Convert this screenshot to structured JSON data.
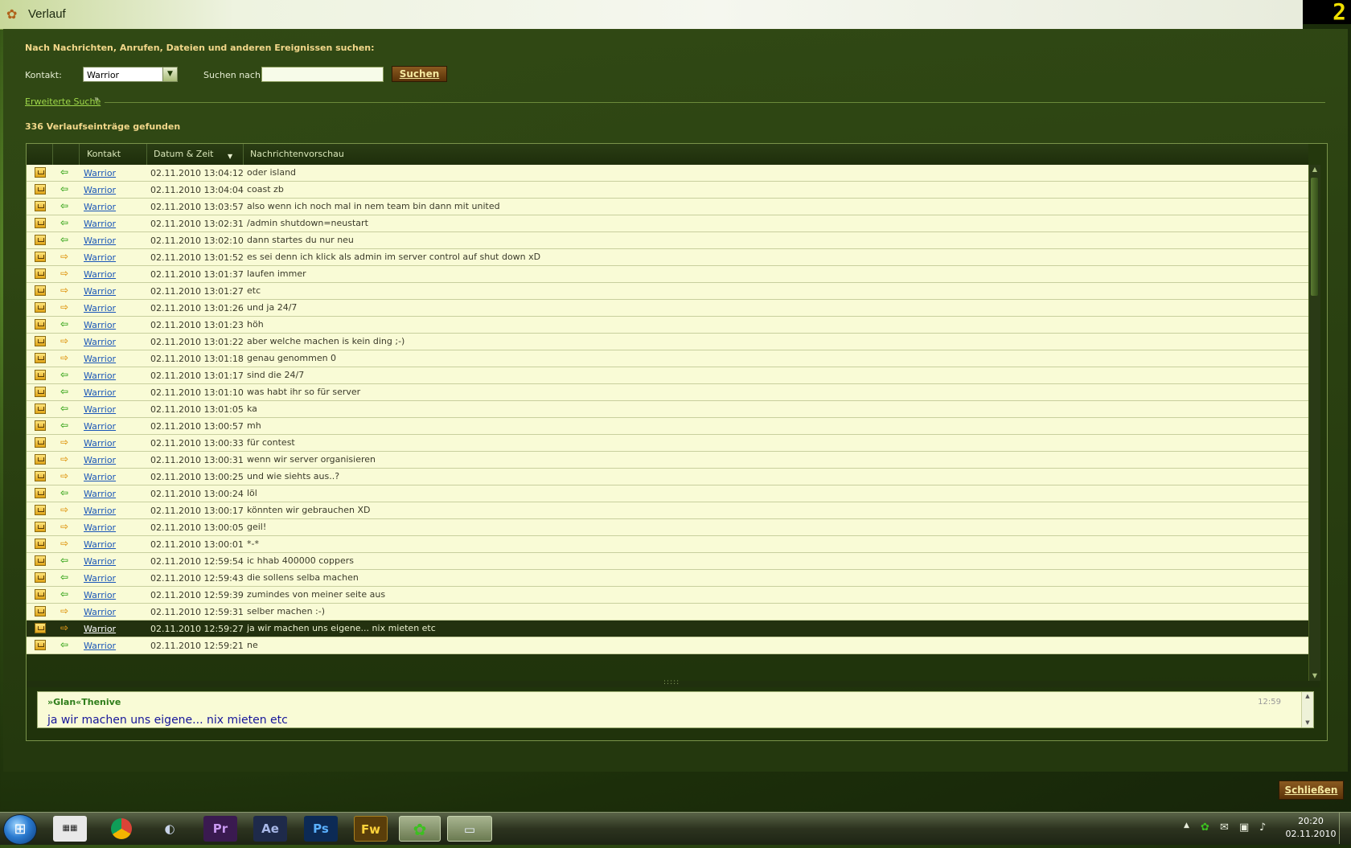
{
  "window": {
    "title": "Verlauf",
    "corner_badge": "2"
  },
  "search": {
    "heading": "Nach Nachrichten, Anrufen, Dateien und anderen Ereignissen suchen:",
    "contact_label": "Kontakt:",
    "contact_value": "Warrior",
    "search_label": "Suchen nach:",
    "search_value": "",
    "search_button": "Suchen",
    "advanced_link": "Erweiterte Suche"
  },
  "results": {
    "count_text": "336 Verlaufseinträge gefunden"
  },
  "grid": {
    "columns": [
      "",
      "",
      "Kontakt",
      "Datum & Zeit",
      "Nachrichtenvorschau"
    ],
    "sort_column": "Datum & Zeit",
    "rows": [
      {
        "dir": "in",
        "contact": "Warrior",
        "date": "02.11.2010 13:04:12",
        "message": " oder island"
      },
      {
        "dir": "in",
        "contact": "Warrior",
        "date": "02.11.2010 13:04:04",
        "message": " coast zb"
      },
      {
        "dir": "in",
        "contact": "Warrior",
        "date": "02.11.2010 13:03:57",
        "message": "also wenn ich noch mal in nem team bin dann mit united"
      },
      {
        "dir": "in",
        "contact": "Warrior",
        "date": "02.11.2010 13:02:31",
        "message": "/admin shutdown=neustart"
      },
      {
        "dir": "in",
        "contact": "Warrior",
        "date": "02.11.2010 13:02:10",
        "message": "dann startes du nur neu"
      },
      {
        "dir": "out",
        "contact": "Warrior",
        "date": "02.11.2010 13:01:52",
        "message": "es sei denn ich klick als admin im server control auf shut down xD"
      },
      {
        "dir": "out",
        "contact": "Warrior",
        "date": "02.11.2010 13:01:37",
        "message": "laufen immer"
      },
      {
        "dir": "out",
        "contact": "Warrior",
        "date": "02.11.2010 13:01:27",
        "message": "etc"
      },
      {
        "dir": "out",
        "contact": "Warrior",
        "date": "02.11.2010 13:01:26",
        "message": "und ja 24/7"
      },
      {
        "dir": "in",
        "contact": "Warrior",
        "date": "02.11.2010 13:01:23",
        "message": " höh"
      },
      {
        "dir": "out",
        "contact": "Warrior",
        "date": "02.11.2010 13:01:22",
        "message": "aber welche machen is kein ding ;-)"
      },
      {
        "dir": "out",
        "contact": "Warrior",
        "date": "02.11.2010 13:01:18",
        "message": "genau genommen 0"
      },
      {
        "dir": "in",
        "contact": "Warrior",
        "date": "02.11.2010 13:01:17",
        "message": " sind die 24/7"
      },
      {
        "dir": "in",
        "contact": "Warrior",
        "date": "02.11.2010 13:01:10",
        "message": " was habt ihr so für server"
      },
      {
        "dir": "in",
        "contact": "Warrior",
        "date": "02.11.2010 13:01:05",
        "message": " ka"
      },
      {
        "dir": "in",
        "contact": "Warrior",
        "date": "02.11.2010 13:00:57",
        "message": " mh"
      },
      {
        "dir": "out",
        "contact": "Warrior",
        "date": "02.11.2010 13:00:33",
        "message": "für contest"
      },
      {
        "dir": "out",
        "contact": "Warrior",
        "date": "02.11.2010 13:00:31",
        "message": "wenn wir server organisieren"
      },
      {
        "dir": "out",
        "contact": "Warrior",
        "date": "02.11.2010 13:00:25",
        "message": "und wie siehts aus..?"
      },
      {
        "dir": "in",
        "contact": "Warrior",
        "date": "02.11.2010 13:00:24",
        "message": " löl"
      },
      {
        "dir": "out",
        "contact": "Warrior",
        "date": "02.11.2010 13:00:17",
        "message": "könnten wir gebrauchen XD"
      },
      {
        "dir": "out",
        "contact": "Warrior",
        "date": "02.11.2010 13:00:05",
        "message": "geil!"
      },
      {
        "dir": "out",
        "contact": "Warrior",
        "date": "02.11.2010 13:00:01",
        "message": "*-*"
      },
      {
        "dir": "in",
        "contact": "Warrior",
        "date": "02.11.2010 12:59:54",
        "message": " ic hhab 400000 coppers"
      },
      {
        "dir": "in",
        "contact": "Warrior",
        "date": "02.11.2010 12:59:43",
        "message": " die sollens selba machen"
      },
      {
        "dir": "in",
        "contact": "Warrior",
        "date": "02.11.2010 12:59:39",
        "message": "zumindes von meiner seite aus"
      },
      {
        "dir": "out",
        "contact": "Warrior",
        "date": "02.11.2010 12:59:31",
        "message": "selber machen :-)"
      },
      {
        "dir": "out",
        "contact": "Warrior",
        "date": "02.11.2010 12:59:27",
        "message": "ja wir machen uns eigene... nix mieten etc",
        "selected": true
      },
      {
        "dir": "in",
        "contact": "Warrior",
        "date": "02.11.2010 12:59:21",
        "message": " ne"
      }
    ]
  },
  "preview": {
    "sender": "»Glan«Thenive",
    "time": "12:59",
    "message": "ja wir machen uns eigene... nix mieten etc"
  },
  "footer": {
    "close_button": "Schließen"
  },
  "taskbar": {
    "apps": [
      {
        "name": "cubase-icon",
        "label": ""
      },
      {
        "name": "chrome-icon",
        "label": ""
      },
      {
        "name": "steam-icon",
        "label": ""
      },
      {
        "name": "premiere-icon",
        "label": "Pr"
      },
      {
        "name": "after-effects-icon",
        "label": "Ae"
      },
      {
        "name": "photoshop-icon",
        "label": "Ps"
      },
      {
        "name": "fireworks-icon",
        "label": "Fw"
      },
      {
        "name": "icq-icon",
        "label": ""
      },
      {
        "name": "monitor-icon",
        "label": ""
      }
    ],
    "clock_time": "20:20",
    "clock_date": "02.11.2010"
  },
  "colors": {
    "accent": "#f2d78a",
    "row_bg": "#f9fbd6",
    "selected_bg": "#23310f",
    "link": "#1a56b8",
    "incoming": "#3aa61e",
    "outgoing": "#e09a1a"
  }
}
